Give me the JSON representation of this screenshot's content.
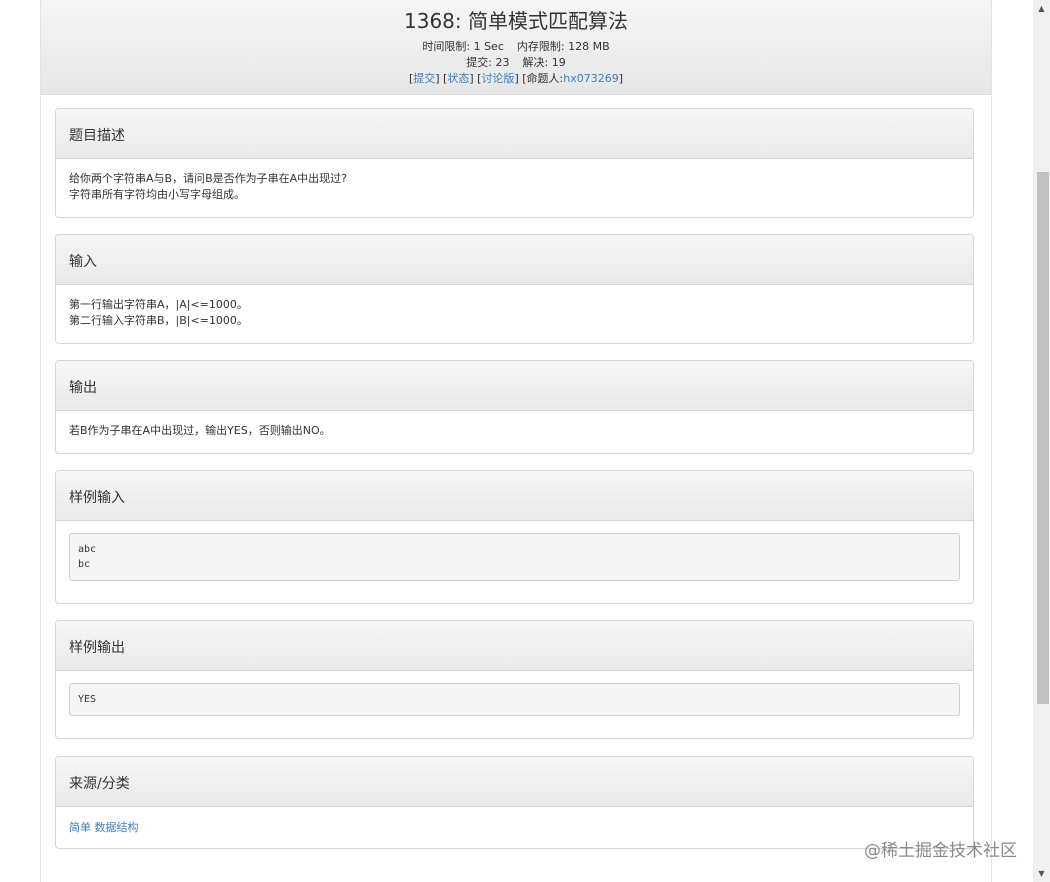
{
  "problem": {
    "title": "1368: 简单模式匹配算法",
    "time_limit_label": "时间限制:",
    "time_limit": "1 Sec",
    "memory_limit_label": "内存限制:",
    "memory_limit": "128 MB",
    "submit_label": "提交:",
    "submit_count": "23",
    "solved_label": "解决:",
    "solved_count": "19",
    "links": {
      "submit": "提交",
      "status": "状态",
      "discuss": "讨论版",
      "author_label": "命题人:",
      "author": "hx073269"
    }
  },
  "sections": {
    "description": {
      "heading": "题目描述",
      "lines": [
        "给你两个字符串A与B，请问B是否作为子串在A中出现过?",
        "字符串所有字符均由小写字母组成。"
      ]
    },
    "input": {
      "heading": "输入",
      "lines": [
        "第一行输出字符串A，|A|<=1000。",
        "第二行输入字符串B，|B|<=1000。"
      ]
    },
    "output": {
      "heading": "输出",
      "lines": [
        "若B作为子串在A中出现过，输出YES，否则输出NO。"
      ]
    },
    "sample_input": {
      "heading": "样例输入",
      "lines": [
        "abc",
        "bc"
      ]
    },
    "sample_output": {
      "heading": "样例输出",
      "lines": [
        "YES"
      ]
    },
    "source": {
      "heading": "来源/分类",
      "tags": [
        "简单",
        "数据结构"
      ]
    }
  },
  "watermark": "@稀土掘金技术社区",
  "icons": [
    "scroll-up-arrow-icon",
    "scroll-down-arrow-icon"
  ]
}
